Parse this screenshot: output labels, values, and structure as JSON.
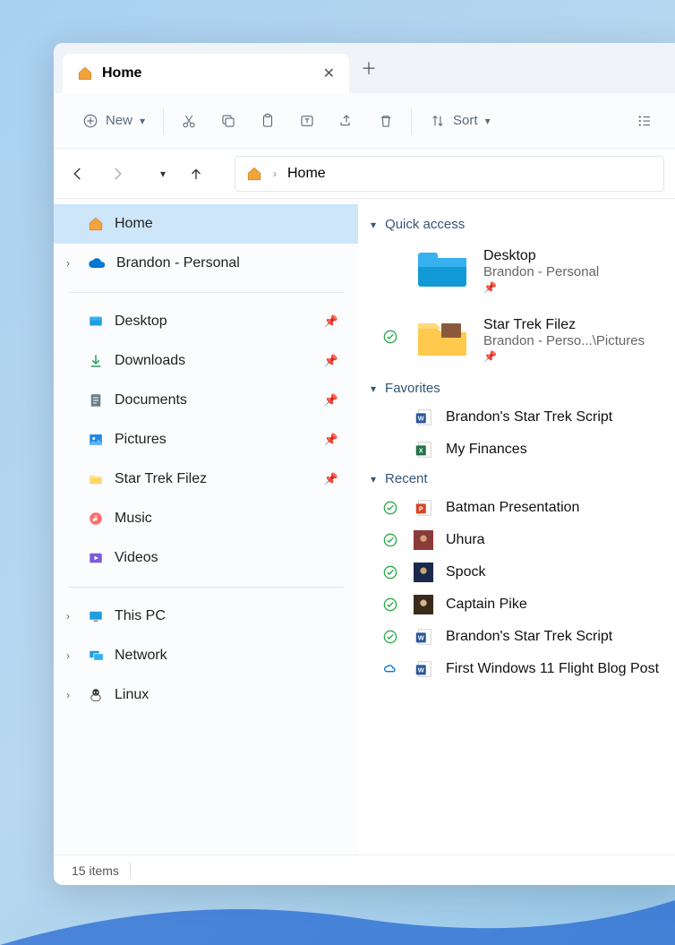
{
  "tab": {
    "title": "Home"
  },
  "toolbar": {
    "new": "New",
    "sort": "Sort"
  },
  "breadcrumb": {
    "location": "Home"
  },
  "sidebar": {
    "home": "Home",
    "onedrive": "Brandon - Personal",
    "items": [
      {
        "label": "Desktop",
        "pinned": true
      },
      {
        "label": "Downloads",
        "pinned": true
      },
      {
        "label": "Documents",
        "pinned": true
      },
      {
        "label": "Pictures",
        "pinned": true
      },
      {
        "label": "Star Trek Filez",
        "pinned": true
      },
      {
        "label": "Music",
        "pinned": false
      },
      {
        "label": "Videos",
        "pinned": false
      }
    ],
    "thispc": "This PC",
    "network": "Network",
    "linux": "Linux"
  },
  "sections": {
    "quick_access": "Quick access",
    "favorites": "Favorites",
    "recent": "Recent"
  },
  "quick_access": [
    {
      "title": "Desktop",
      "sub": "Brandon - Personal"
    },
    {
      "title": "Star Trek Filez",
      "sub": "Brandon - Perso...\\Pictures"
    }
  ],
  "favorites": [
    {
      "title": "Brandon's Star Trek Script",
      "type": "word"
    },
    {
      "title": "My Finances",
      "type": "excel"
    }
  ],
  "recent": [
    {
      "title": "Batman Presentation",
      "type": "ppt",
      "synced": true
    },
    {
      "title": "Uhura",
      "type": "img",
      "synced": true
    },
    {
      "title": "Spock",
      "type": "img",
      "synced": true
    },
    {
      "title": "Captain Pike",
      "type": "img",
      "synced": true
    },
    {
      "title": "Brandon's Star Trek Script",
      "type": "word",
      "synced": true
    },
    {
      "title": "First Windows 11 Flight Blog Post",
      "type": "word",
      "cloud": true
    }
  ],
  "status": {
    "count": "15 items"
  }
}
